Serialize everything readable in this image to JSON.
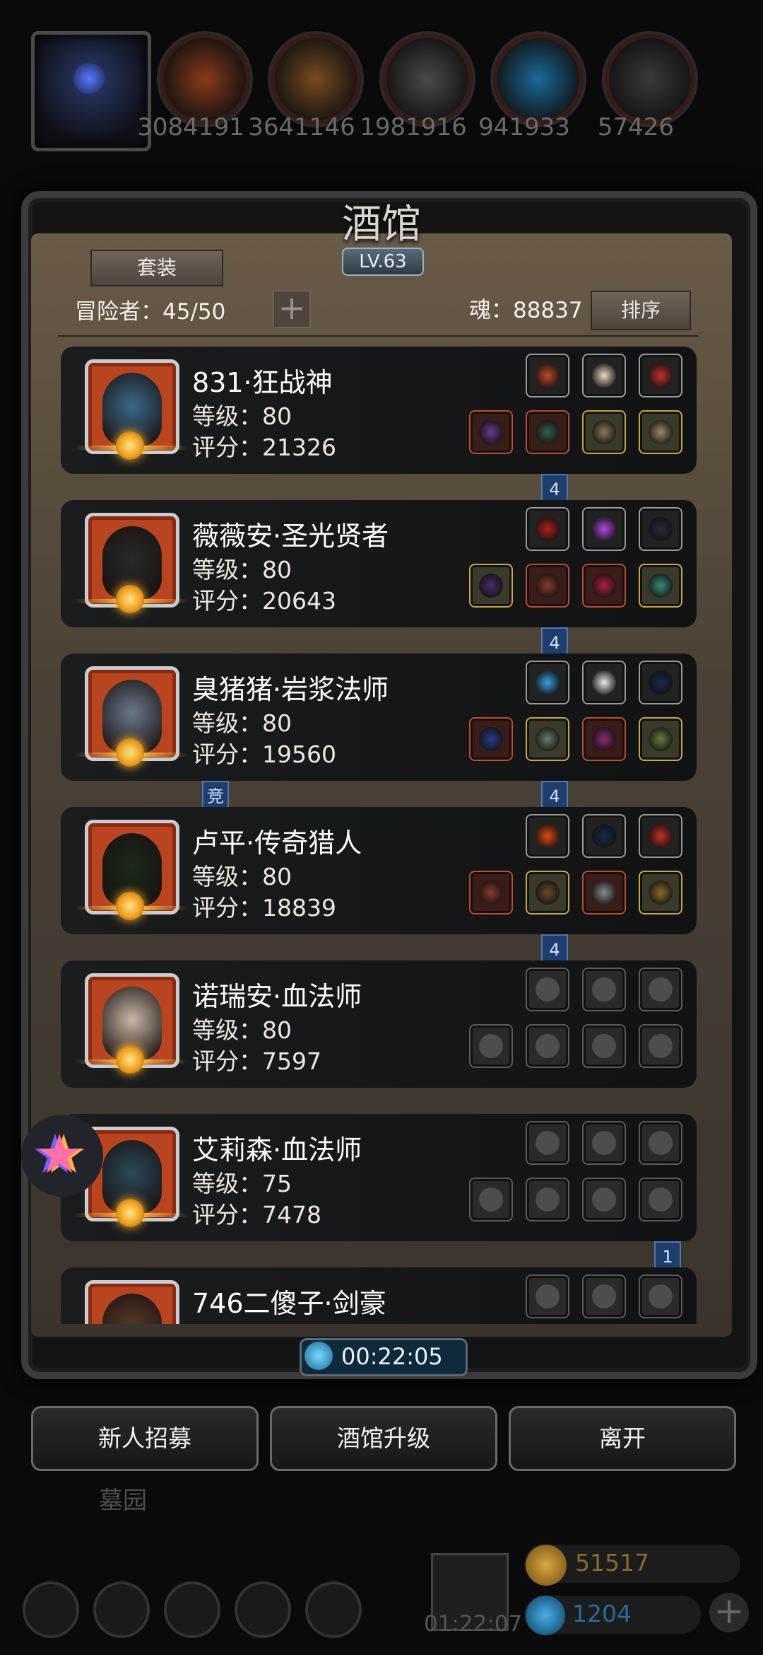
{
  "resources": [
    {
      "name": "meat",
      "value": "3084191",
      "color": "#8a3a1a"
    },
    {
      "name": "wood",
      "value": "3641146",
      "color": "#7a4a20"
    },
    {
      "name": "iron",
      "value": "1981916",
      "color": "#4a4a4a"
    },
    {
      "name": "crystal",
      "value": "941933",
      "color": "#1a6a9a"
    },
    {
      "name": "steel",
      "value": "57426",
      "color": "#3a3a3a"
    }
  ],
  "tavern": {
    "title": "酒馆",
    "level": "LV.63",
    "set_button": "套装",
    "adventurers_label": "冒险者：45/50",
    "add_button": "+",
    "soul_label": "魂：88837",
    "sort_button": "排序"
  },
  "heroes": [
    {
      "name": "831·狂战神",
      "level": "等级：80",
      "score": "评分：21326",
      "portrait": "#3a6a8a",
      "top": [
        "#c24a2a",
        "#e8d8c0",
        "#c2302a"
      ],
      "bottom": [
        "#6a3a8a",
        "#3a5a4a",
        "#8a7a5a",
        "#9a8a6a"
      ],
      "top_styles": [
        "",
        "",
        ""
      ],
      "bottom_styles": [
        "red",
        "red",
        "gold",
        "gold"
      ],
      "flag": "4",
      "badge": ""
    },
    {
      "name": "薇薇安·圣光贤者",
      "level": "等级：80",
      "score": "评分：20643",
      "portrait": "#2a2a2a",
      "top": [
        "#b02020",
        "#b04ae0",
        "#2a2a3a"
      ],
      "bottom": [
        "#4a2a6a",
        "#8a3a2a",
        "#b02040",
        "#3a8a7a"
      ],
      "top_styles": [
        "",
        "",
        ""
      ],
      "bottom_styles": [
        "gold",
        "red",
        "red",
        "gold"
      ],
      "flag": "4",
      "badge": ""
    },
    {
      "name": "臭猪猪·岩浆法师",
      "level": "等级：80",
      "score": "评分：19560",
      "portrait": "#6a7a8a",
      "top": [
        "#3aa0e0",
        "#e8e8e8",
        "#1a2a4a"
      ],
      "bottom": [
        "#2a3a8a",
        "#6a7a6a",
        "#8a2a6a",
        "#6a7a3a"
      ],
      "top_styles": [
        "",
        "",
        ""
      ],
      "bottom_styles": [
        "red",
        "gold",
        "red",
        "gold"
      ],
      "flag": "4",
      "badge": "竞"
    },
    {
      "name": "卢平·传奇猎人",
      "level": "等级：80",
      "score": "评分：18839",
      "portrait": "#1a2a1a",
      "top": [
        "#e04a10",
        "#1a2a4a",
        "#c2302a"
      ],
      "bottom": [
        "#8a3a2a",
        "#6a4a2a",
        "#8a8a8a",
        "#8a6a2a"
      ],
      "top_styles": [
        "",
        "",
        ""
      ],
      "bottom_styles": [
        "red",
        "gold",
        "red",
        "gold"
      ],
      "flag": "4",
      "badge": ""
    },
    {
      "name": "诺瑞安·血法师",
      "level": "等级：80",
      "score": "评分：7597",
      "portrait": "#c8b8a8",
      "top": [
        "",
        "",
        ""
      ],
      "bottom": [
        "",
        "",
        "",
        ""
      ],
      "top_styles": [
        "empty",
        "empty",
        "empty"
      ],
      "bottom_styles": [
        "empty",
        "empty",
        "empty",
        "empty"
      ],
      "flag": "",
      "badge": ""
    },
    {
      "name": "艾莉森·血法师",
      "level": "等级：75",
      "score": "评分：7478",
      "portrait": "#2a4a5a",
      "top": [
        "",
        "",
        ""
      ],
      "bottom": [
        "",
        "",
        "",
        ""
      ],
      "top_styles": [
        "empty",
        "empty",
        "empty"
      ],
      "bottom_styles": [
        "empty",
        "empty",
        "empty",
        "empty"
      ],
      "flag": "1",
      "badge": ""
    },
    {
      "name": "746二傻子·剑豪",
      "level": "等级：",
      "score": "",
      "portrait": "#5a3a2a",
      "top": [
        "",
        "",
        ""
      ],
      "bottom": [
        "",
        "",
        "",
        ""
      ],
      "top_styles": [
        "empty",
        "empty",
        "empty"
      ],
      "bottom_styles": [
        "empty",
        "empty",
        "empty",
        "empty"
      ],
      "flag": "",
      "badge": ""
    }
  ],
  "timer": "00:22:05",
  "buttons": {
    "recruit": "新人招募",
    "upgrade": "酒馆升级",
    "leave": "离开"
  },
  "graveyard": "墓园",
  "gift_timer": "01:22:07",
  "currency": {
    "gold": "51517",
    "gems": "1204"
  }
}
